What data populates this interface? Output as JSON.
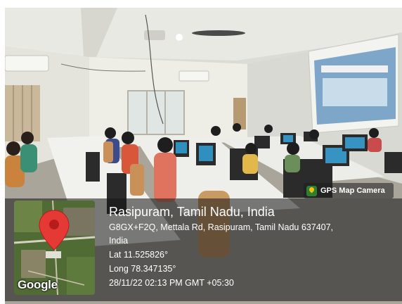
{
  "badge": {
    "label": "GPS Map Camera",
    "icon": "gps-map-camera-app-icon"
  },
  "location": {
    "title": "Rasipuram, Tamil Nadu, India",
    "address_line1": "G8GX+F2Q, Mettala Rd, Rasipuram, Tamil Nadu 637407,",
    "address_line2": "India",
    "latitude": "Lat 11.525826°",
    "longitude": "Long 78.347135°",
    "timestamp": "28/11/22 02:13 PM GMT +05:30"
  },
  "map": {
    "attribution": "Google",
    "pin_color": "#e53935"
  }
}
